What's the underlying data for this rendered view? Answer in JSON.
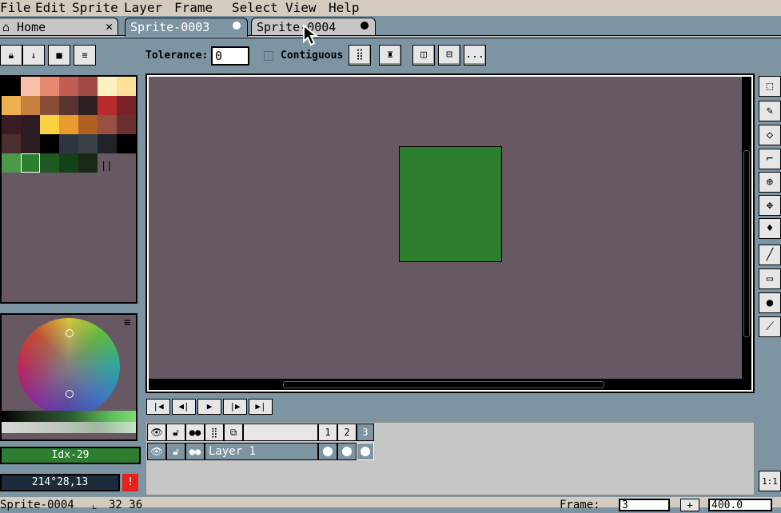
{
  "menu": {
    "file": "File",
    "edit": "Edit",
    "sprite": "Sprite",
    "layer": "Layer",
    "frame": "Frame",
    "select": "Select",
    "view": "View",
    "help": "Help"
  },
  "tabs": {
    "home": "Home",
    "sprite3": "Sprite-0003",
    "sprite4": "Sprite-0004"
  },
  "context": {
    "tolerance_label": "Tolerance:",
    "tolerance_value": "0",
    "contiguous_label": "Contiguous",
    "more_label": "..."
  },
  "left_status": {
    "index_label": "Idx-29",
    "color_value": "214°28,13",
    "warning": "!"
  },
  "palette_menu": "≡",
  "palette_sep": "||",
  "timeline": {
    "layer_name": "Layer 1",
    "frames": [
      "1",
      "2",
      "3"
    ]
  },
  "statusbar": {
    "sprite_name": "Sprite-0004",
    "size": "32 36",
    "frame_label": "Frame:",
    "frame_value": "3",
    "plus": "+",
    "zoom": "400.0"
  },
  "zoom_reset": "1:1",
  "colors": {
    "canvas_bg": "#675863",
    "sprite_fill": "#2d7f2f",
    "index_badge": "#2d7f2f",
    "color_badge": "#1d2c3c",
    "warning": "#e5221b"
  }
}
